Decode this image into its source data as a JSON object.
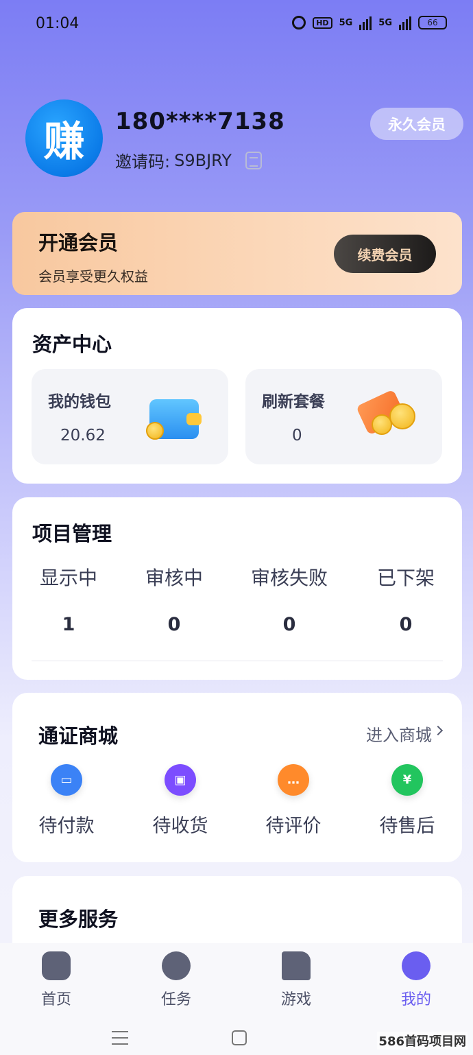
{
  "status_bar": {
    "time": "01:04",
    "hd": "HD",
    "net1": "5G",
    "net2": "5G",
    "battery": "66"
  },
  "profile": {
    "avatar_char": "赚",
    "phone": "180****7138",
    "invite_label": "邀请码:",
    "invite_code": "S9BJRY",
    "vip_badge": "永久会员"
  },
  "vip_banner": {
    "title": "开通会员",
    "subtitle": "会员享受更久权益",
    "button": "续费会员"
  },
  "assets": {
    "title": "资产中心",
    "items": [
      {
        "label": "我的钱包",
        "value": "20.62"
      },
      {
        "label": "刷新套餐",
        "value": "0"
      }
    ]
  },
  "projects": {
    "title": "项目管理",
    "items": [
      {
        "label": "显示中",
        "count": "1"
      },
      {
        "label": "审核中",
        "count": "0"
      },
      {
        "label": "审核失败",
        "count": "0"
      },
      {
        "label": "已下架",
        "count": "0"
      }
    ]
  },
  "mall": {
    "title": "通证商城",
    "link": "进入商城",
    "items": [
      {
        "label": "待付款",
        "icon": "wallet-icon",
        "color": "#3b82f6"
      },
      {
        "label": "待收货",
        "icon": "package-icon",
        "color": "#7c4dff"
      },
      {
        "label": "待评价",
        "icon": "chat-bubble-icon",
        "color": "#ff8a2b"
      },
      {
        "label": "待售后",
        "icon": "yuan-coin-icon",
        "color": "#22c55e"
      }
    ]
  },
  "services": {
    "title": "更多服务"
  },
  "nav": {
    "items": [
      {
        "label": "首页",
        "icon": "home-icon"
      },
      {
        "label": "任务",
        "icon": "task-icon"
      },
      {
        "label": "游戏",
        "icon": "game-doc-icon"
      },
      {
        "label": "我的",
        "icon": "profile-icon"
      }
    ],
    "active_color": "#6a5ef0"
  },
  "watermark": "586首码项目网"
}
